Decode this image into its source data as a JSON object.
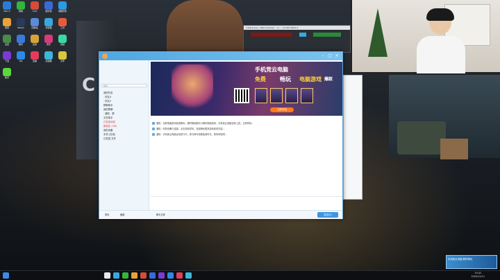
{
  "desktop": {
    "wall_letter": "C",
    "icons": [
      {
        "label": "Neo-2",
        "color": "#2b7bd6"
      },
      {
        "label": "微信",
        "color": "#2fb83b"
      },
      {
        "label": "mod",
        "color": "#d84a3a"
      },
      {
        "label": "图书馆",
        "color": "#3a6ad8"
      },
      {
        "label": "电脑管家",
        "color": "#2a9ae8"
      },
      {
        "label": "游戏",
        "color": "#e8a23a"
      },
      {
        "label": "Steam",
        "color": "#2a3a5a"
      },
      {
        "label": "回收站",
        "color": "#5a8ad8"
      },
      {
        "label": "浏览器",
        "color": "#3aa8e0"
      },
      {
        "label": "工具",
        "color": "#e85a3a"
      },
      {
        "label": "设置",
        "color": "#4a8a4a"
      },
      {
        "label": "腾讯",
        "color": "#3a7ad8"
      },
      {
        "label": "应用",
        "color": "#d8a23a"
      },
      {
        "label": "音乐",
        "color": "#d83a7a"
      },
      {
        "label": "视频",
        "color": "#3ad8a2"
      },
      {
        "label": "下载",
        "color": "#7a3ad8"
      },
      {
        "label": "QQ",
        "color": "#2a8ae8"
      },
      {
        "label": "直播",
        "color": "#e83a5a"
      },
      {
        "label": "加速器",
        "color": "#3ab8d8"
      },
      {
        "label": "文件",
        "color": "#d8c83a"
      },
      {
        "label": "助手",
        "color": "#5ad83a"
      }
    ]
  },
  "daw": {
    "title": "cubase proj - ASIO channel ··· rs ··· ok 192.168.0.1"
  },
  "qq": {
    "sidebar": {
      "search_placeholder": "搜索",
      "rows": [
        {
          "text": "我的好友"
        },
        {
          "text": "· 好友4"
        },
        {
          "text": "· 好友2"
        },
        {
          "text": "群聊助手"
        },
        {
          "text": "我的群聊"
        },
        {
          "text": "· 通知 - 群"
        },
        {
          "text": "文件助手"
        },
        {
          "text": "已发送消息",
          "red": true
        },
        {
          "text": "新朋友 (4/6)",
          "red": true
        },
        {
          "text": "我的设备"
        },
        {
          "text": "手机 (在线)"
        },
        {
          "text": "已发送 文件"
        }
      ]
    },
    "banner": {
      "line1": "手机竞云电脑",
      "line2a": "免费",
      "line2b": "畅玩",
      "line2c": "电脑游戏",
      "line2d": "爆款",
      "cta": "立即体验"
    },
    "messages": [
      "通知：全新电脑游戏免费畅玩，随时随地都可以畅玩电脑游戏，手机竞云电脑全新上线，立即体验...",
      "通知：你的设备已连接，点击查看详情，在线畅玩更多游戏精彩内容...",
      "通知：手机竞云电脑活动进行中，参与即可领取免费时长，快来体验吧..."
    ],
    "bottom": {
      "btn1": "表情",
      "btn2": "截图",
      "btn3": "聊天记录",
      "send": "发送(S)"
    }
  },
  "taskbar": {
    "time": "19:42",
    "date": "2020/12/11"
  },
  "promo": {
    "text": "手机竞云电脑 随时畅玩"
  }
}
